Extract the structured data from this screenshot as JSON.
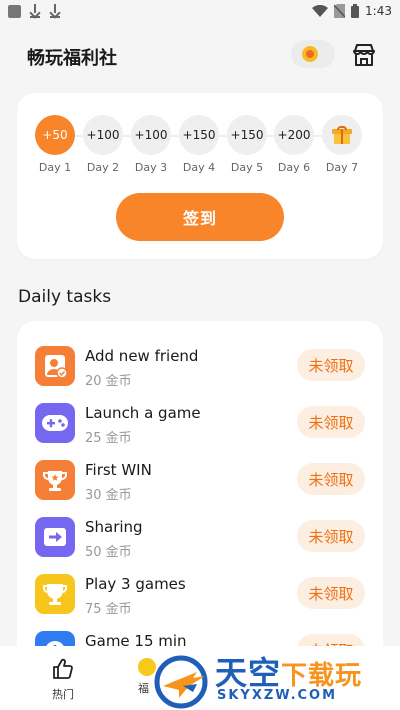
{
  "status_bar": {
    "time": "1:43"
  },
  "header": {
    "title": "畅玩福利社"
  },
  "checkin": {
    "days": [
      {
        "reward": "+50",
        "label": "Day 1",
        "active": true
      },
      {
        "reward": "+100",
        "label": "Day 2"
      },
      {
        "reward": "+100",
        "label": "Day 3"
      },
      {
        "reward": "+150",
        "label": "Day 4"
      },
      {
        "reward": "+150",
        "label": "Day 5"
      },
      {
        "reward": "+200",
        "label": "Day 6"
      },
      {
        "reward": "",
        "label": "Day 7",
        "icon": "gift-icon"
      }
    ],
    "button_label": "签到"
  },
  "tasks": {
    "section_title": "Daily tasks",
    "items": [
      {
        "title": "Add new friend",
        "reward": "20 金币",
        "button": "未领取",
        "icon": "add-friend-icon",
        "color": "#f57f36"
      },
      {
        "title": "Launch a game",
        "reward": "25 金币",
        "button": "未领取",
        "icon": "gamepad-icon",
        "color": "#7667f0"
      },
      {
        "title": "First WIN",
        "reward": "30 金币",
        "button": "未领取",
        "icon": "trophy-icon",
        "color": "#f57f36"
      },
      {
        "title": "Sharing",
        "reward": "50 金币",
        "button": "未领取",
        "icon": "share-icon",
        "color": "#7667f0"
      },
      {
        "title": "Play 3 games",
        "reward": "75 金币",
        "button": "未领取",
        "icon": "cup-icon",
        "color": "#f7c51b"
      },
      {
        "title": "Game 15 min",
        "reward": "",
        "button": "未领取",
        "icon": "clock-icon",
        "color": "#2f7cf0"
      }
    ]
  },
  "bottom_nav": {
    "hot_label": "热门",
    "second_label": "福"
  },
  "watermark": {
    "cn_blue": "天空",
    "cn_orange": "下载玩",
    "en": "SKYXZW.COM"
  },
  "colors": {
    "accent": "#f8852a",
    "claim_bg": "#fdeee2",
    "claim_text": "#f06f14"
  }
}
